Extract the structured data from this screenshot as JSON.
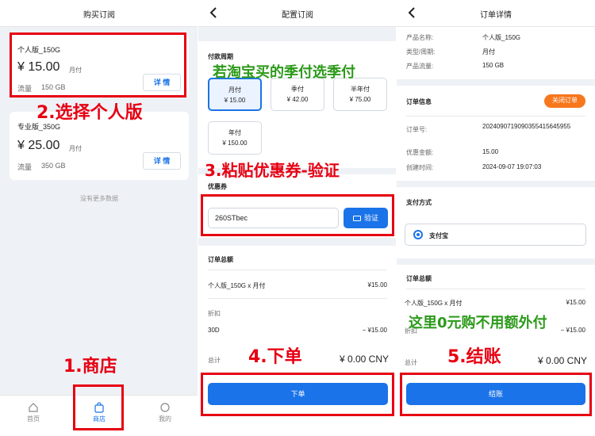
{
  "panel1": {
    "title": "购买订阅",
    "plans": [
      {
        "name": "个人版_150G",
        "price": "¥ 15.00",
        "period": "月付",
        "flow_label": "流量",
        "flow_value": "150 GB",
        "detail": "详 情"
      },
      {
        "name": "专业版_350G",
        "price": "¥ 25.00",
        "period": "月付",
        "flow_label": "流量",
        "flow_value": "350 GB",
        "detail": "详 情"
      }
    ],
    "no_more": "没有更多数据",
    "tabs": [
      {
        "label": "首页",
        "icon": "home-icon"
      },
      {
        "label": "商店",
        "icon": "shopping-bag-icon"
      },
      {
        "label": "我的",
        "icon": "profile-icon"
      }
    ],
    "annotation_step2": "2.选择个人版",
    "annotation_step1": "1.商店"
  },
  "panel2": {
    "title": "配置订阅",
    "cycle_section": "付款周期",
    "cycles": [
      {
        "name": "月付",
        "price": "¥ 15.00",
        "selected": true
      },
      {
        "name": "季付",
        "price": "¥ 42.00",
        "selected": false
      },
      {
        "name": "半年付",
        "price": "¥ 75.00",
        "selected": false
      },
      {
        "name": "年付",
        "price": "¥ 150.00",
        "selected": false
      }
    ],
    "annotation_tip": "若淘宝买的季付选季付",
    "annotation_step3": "3.粘贴优惠券-验证",
    "coupon_section": "优惠券",
    "coupon_value": "260STbec",
    "verify_label": "验证",
    "total_section": "订单总额",
    "line_item": "个人版_150G x 月付",
    "line_price": "¥15.00",
    "discount_label": "折扣",
    "discount_code": "30D",
    "discount_value": "− ¥15.00",
    "total_label": "总计",
    "total_value": "¥ 0.00 CNY",
    "order_btn": "下单",
    "annotation_step4": "4.下单"
  },
  "panel3": {
    "title": "订单详情",
    "product_rows": [
      {
        "k": "产品名称:",
        "v": "个人版_150G"
      },
      {
        "k": "类型/周期:",
        "v": "月付"
      },
      {
        "k": "产品流量:",
        "v": "150 GB"
      }
    ],
    "order_info": "订单信息",
    "close_order": "关闭订单",
    "order_no_label": "订单号:",
    "order_no_line1": "20240907190903554156459 5",
    "order_no_line2": "5",
    "discount_label": "优惠金额:",
    "discount_value": "15.00",
    "created_label": "创建时间:",
    "created_value": "2024-09-07 19:07:03",
    "payment_section": "支付方式",
    "payment_option": "支付宝",
    "total_section": "订单总额",
    "line_item": "个人版_150G x 月付",
    "line_price": "¥15.00",
    "discount_short": "折扣",
    "discount_price": "− ¥15.00",
    "total_label": "总计",
    "total_value": "¥ 0.00 CNY",
    "checkout_btn": "结账",
    "annotation_tip": "这里0元购不用额外付",
    "annotation_step5": "5.结账"
  }
}
